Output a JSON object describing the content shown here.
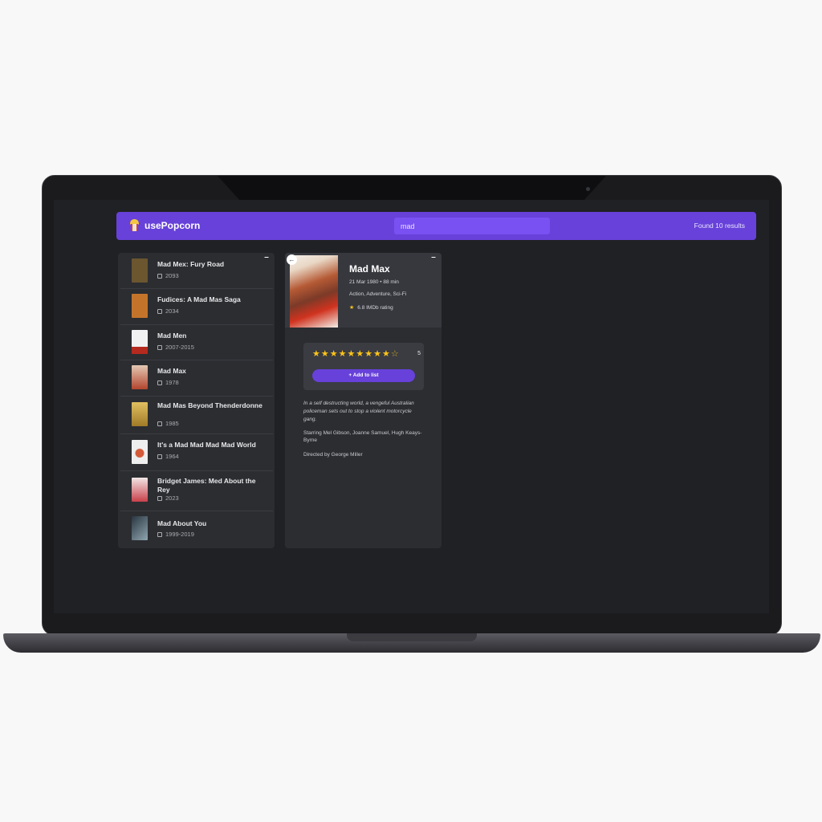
{
  "app": {
    "logo_text": "usePopcorn",
    "accent": "#6741d9"
  },
  "search": {
    "value": "mad",
    "placeholder": "Search movies..."
  },
  "results_text": "Found 10 results",
  "list_toggle": "–",
  "movies": [
    {
      "title": "Mad Mex: Fury Road",
      "year": "2093",
      "poster": "#5a4a2a"
    },
    {
      "title": "Fudices: A Mad Mas Saga",
      "year": "2034",
      "poster": "#c4742a"
    },
    {
      "title": "Mad Men",
      "year": "2007-2015",
      "poster": "#f1f1f1"
    },
    {
      "title": "Mad Max",
      "year": "1978",
      "poster": "#d9b6a0"
    },
    {
      "title": "Mad Mas Beyond Thenderdonne",
      "year": "1985",
      "poster": "#caa34a"
    },
    {
      "title": "It's a Mad Mad Mad Mad World",
      "year": "1964",
      "poster": "#eeeeee"
    },
    {
      "title": "Bridget James: Med About the Rey",
      "year": "2023",
      "poster": "#e8d4d4"
    },
    {
      "title": "Mad About You",
      "year": "1999-2019",
      "poster": "#3a4c5a"
    }
  ],
  "detail": {
    "back_icon": "←",
    "title": "Mad Max",
    "released": "21 Mar 1980 • 88 min",
    "genre": "Action, Adventure, Sci-Fi",
    "imdb": "6.8 IMDb rating",
    "star_count": "5",
    "stars_filled": 9,
    "stars_total": 10,
    "add_button": "+ Add to list",
    "plot": "In a self destructing world, a vengeful Australian policeman sets out to stop a violent motorcycle gang.",
    "starring": "Starring Mel Gibson, Joanne Samuel, Hugh Keays-Byrne",
    "directed": "Directed by George Miller"
  }
}
